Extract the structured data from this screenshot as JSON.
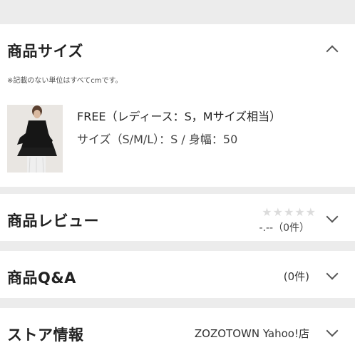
{
  "size_section": {
    "title": "商品サイズ",
    "note": "※記載のない単位はすべてcmです。",
    "item": {
      "name": "FREE（レディース：S，Mサイズ相当）",
      "detail": "サイズ（S/M/L）：S / 身幅：50"
    }
  },
  "review_section": {
    "title": "商品レビュー",
    "stars": "★★★★★",
    "rating_text": "-.--（0件）"
  },
  "qa_section": {
    "title": "商品Q&A",
    "count_text": "(0件)"
  },
  "store_section": {
    "title": "ストア情報",
    "store_name": "ZOZOTOWN Yahoo!店"
  }
}
